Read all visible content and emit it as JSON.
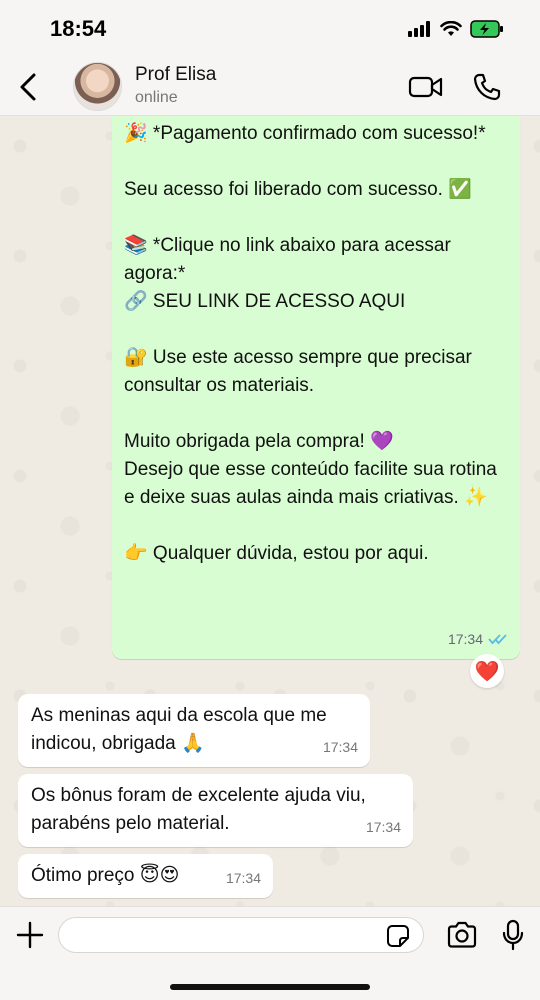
{
  "status_bar": {
    "time": "18:54"
  },
  "header": {
    "contact_name": "Prof Elisa",
    "contact_status": "online"
  },
  "messages": {
    "outgoing": {
      "text": "🎉 *Pagamento confirmado com sucesso!*\n\nSeu acesso foi liberado com sucesso. ✅\n\n📚 *Clique no link abaixo para acessar agora:*\n🔗 SEU LINK DE ACESSO AQUI\n\n🔐 Use este acesso sempre que precisar consultar os materiais.\n\nMuito obrigada pela compra! 💜\nDesejo que esse conteúdo facilite sua rotina e deixe suas aulas ainda mais criativas. ✨\n\n👉 Qualquer dúvida, estou por aqui.",
      "time": "17:34",
      "reaction": "❤️"
    },
    "incoming": [
      {
        "text": "As meninas aqui da escola que me indicou, obrigada 🙏",
        "time": "17:34"
      },
      {
        "text": "Os bônus foram de excelente ajuda viu, parabéns pelo material.",
        "time": "17:34"
      },
      {
        "text": "Ótimo preço 😇😍",
        "time": "17:34"
      }
    ]
  },
  "input": {
    "value": ""
  },
  "colors": {
    "outgoing_bubble": "#d9fdd3",
    "incoming_bubble": "#ffffff",
    "read_ticks": "#53bdeb",
    "battery": "#34c759"
  }
}
